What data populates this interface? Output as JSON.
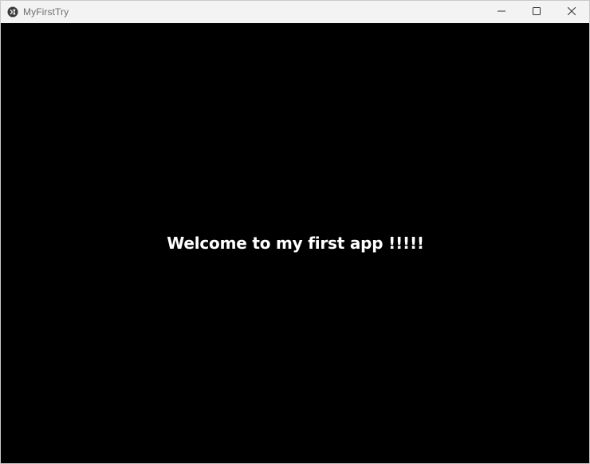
{
  "window": {
    "title": "MyFirstTry",
    "app_icon": "kivy-logo-icon",
    "controls": {
      "minimize_icon": "minimize-icon",
      "maximize_icon": "maximize-icon",
      "close_icon": "close-icon"
    }
  },
  "main": {
    "label_text": "Welcome to my first app !!!!!"
  },
  "colors": {
    "titlebar": "#f3f3f3",
    "canvas_background": "#000000",
    "label_text": "#ffffff"
  }
}
